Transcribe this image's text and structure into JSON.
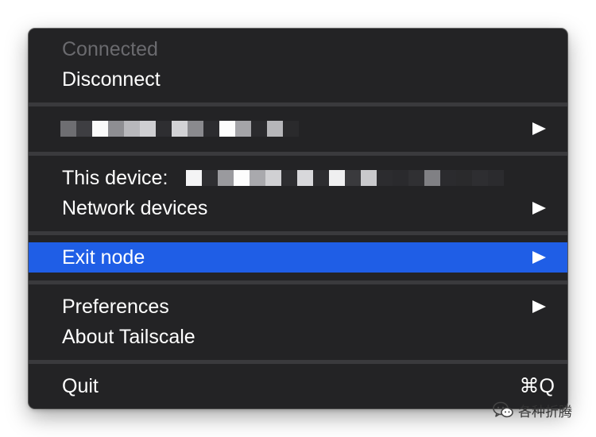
{
  "menu": {
    "status_label": "Connected",
    "disconnect_label": "Disconnect",
    "this_device_label": "This device:",
    "network_devices_label": "Network devices",
    "exit_node_label": "Exit node",
    "preferences_label": "Preferences",
    "about_label": "About Tailscale",
    "quit_label": "Quit",
    "quit_shortcut": "⌘Q"
  },
  "watermark": {
    "text": "各种折腾",
    "icon": "wechat-icon"
  },
  "colors": {
    "menu_background": "#232325",
    "highlight": "#1f5ee6",
    "separator": "#3a3a3d",
    "disabled_text": "#6a6a6e"
  }
}
